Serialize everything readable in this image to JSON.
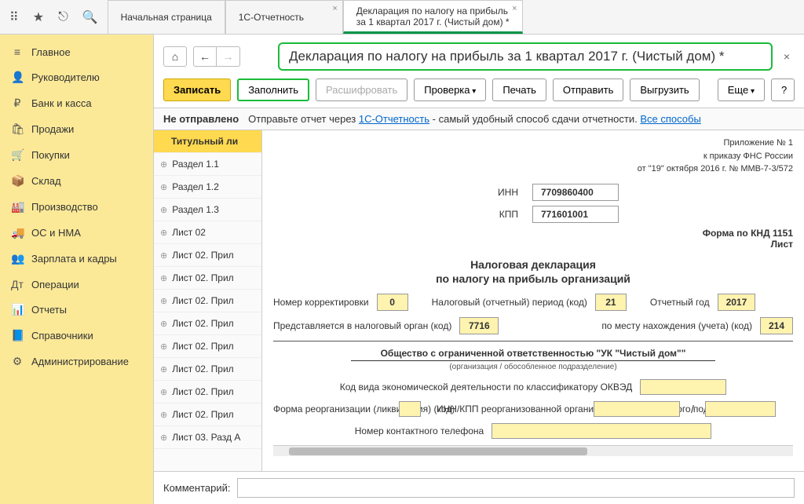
{
  "tabs": {
    "start": "Начальная страница",
    "report": "1С-Отчетность",
    "active": {
      "l1": "Декларация по налогу на прибыль",
      "l2": "за 1 квартал 2017 г. (Чистый дом) *"
    }
  },
  "sidebar": [
    {
      "icon": "≡",
      "label": "Главное"
    },
    {
      "icon": "👤",
      "label": "Руководителю"
    },
    {
      "icon": "₽",
      "label": "Банк и касса"
    },
    {
      "icon": "🛍",
      "label": "Продажи"
    },
    {
      "icon": "🛒",
      "label": "Покупки"
    },
    {
      "icon": "📦",
      "label": "Склад"
    },
    {
      "icon": "🏭",
      "label": "Производство"
    },
    {
      "icon": "🚚",
      "label": "ОС и НМА"
    },
    {
      "icon": "👥",
      "label": "Зарплата и кадры"
    },
    {
      "icon": "Дт",
      "label": "Операции"
    },
    {
      "icon": "📊",
      "label": "Отчеты"
    },
    {
      "icon": "📘",
      "label": "Справочники"
    },
    {
      "icon": "⚙",
      "label": "Администрирование"
    }
  ],
  "doc_title": "Декларация по налогу на прибыль за 1 квартал 2017 г. (Чистый дом) *",
  "toolbar": {
    "write": "Записать",
    "fill": "Заполнить",
    "decode": "Расшифровать",
    "check": "Проверка",
    "print": "Печать",
    "send": "Отправить",
    "export": "Выгрузить",
    "more": "Еще",
    "help": "?"
  },
  "status": {
    "label": "Не отправлено",
    "text1": "Отправьте отчет через ",
    "link1": "1С-Отчетность",
    "text2": " - самый удобный способ сдачи отчетности. ",
    "link2": "Все способы"
  },
  "sections": [
    "Титульный ли",
    "Раздел 1.1",
    "Раздел 1.2",
    "Раздел 1.3",
    "Лист 02",
    "Лист 02. Прил",
    "Лист 02. Прил",
    "Лист 02. Прил",
    "Лист 02. Прил",
    "Лист 02. Прил",
    "Лист 02. Прил",
    "Лист 02. Прил",
    "Лист 02. Прил",
    "Лист 03. Разд А"
  ],
  "form": {
    "hdr1": "Приложение № 1",
    "hdr2": "к приказу ФНС России",
    "hdr3": "от \"19\" октября 2016 г. № ММВ-7-3/572",
    "inn_label": "ИНН",
    "inn": "7709860400",
    "kpp_label": "КПП",
    "kpp": "771601001",
    "knd": "Форма по КНД 1151",
    "sheet": "Лист",
    "decl1": "Налоговая декларация",
    "decl2": "по налогу на прибыль организаций",
    "corr_label": "Номер корректировки",
    "corr": "0",
    "period_label": "Налоговый (отчетный) период (код)",
    "period": "21",
    "year_label": "Отчетный год",
    "year": "2017",
    "organ_label": "Представляется в налоговый орган (код)",
    "organ": "7716",
    "place_label": "по месту нахождения (учета) (код)",
    "place": "214",
    "org_name": "Общество с ограниченной ответственностью \"УК \"Чистый дом\"\"",
    "org_sub": "(организация / обособленное подразделение)",
    "okved_label": "Код вида экономической деятельности по классификатору ОКВЭД",
    "reorg_label": "Форма реорганизации (ликвидация) (код)",
    "reorg_inn_label": "ИНН/КПП реорганизованной организации (обособленного подразделения)",
    "phone_label": "Номер контактного телефона"
  },
  "comment_label": "Комментарий:"
}
